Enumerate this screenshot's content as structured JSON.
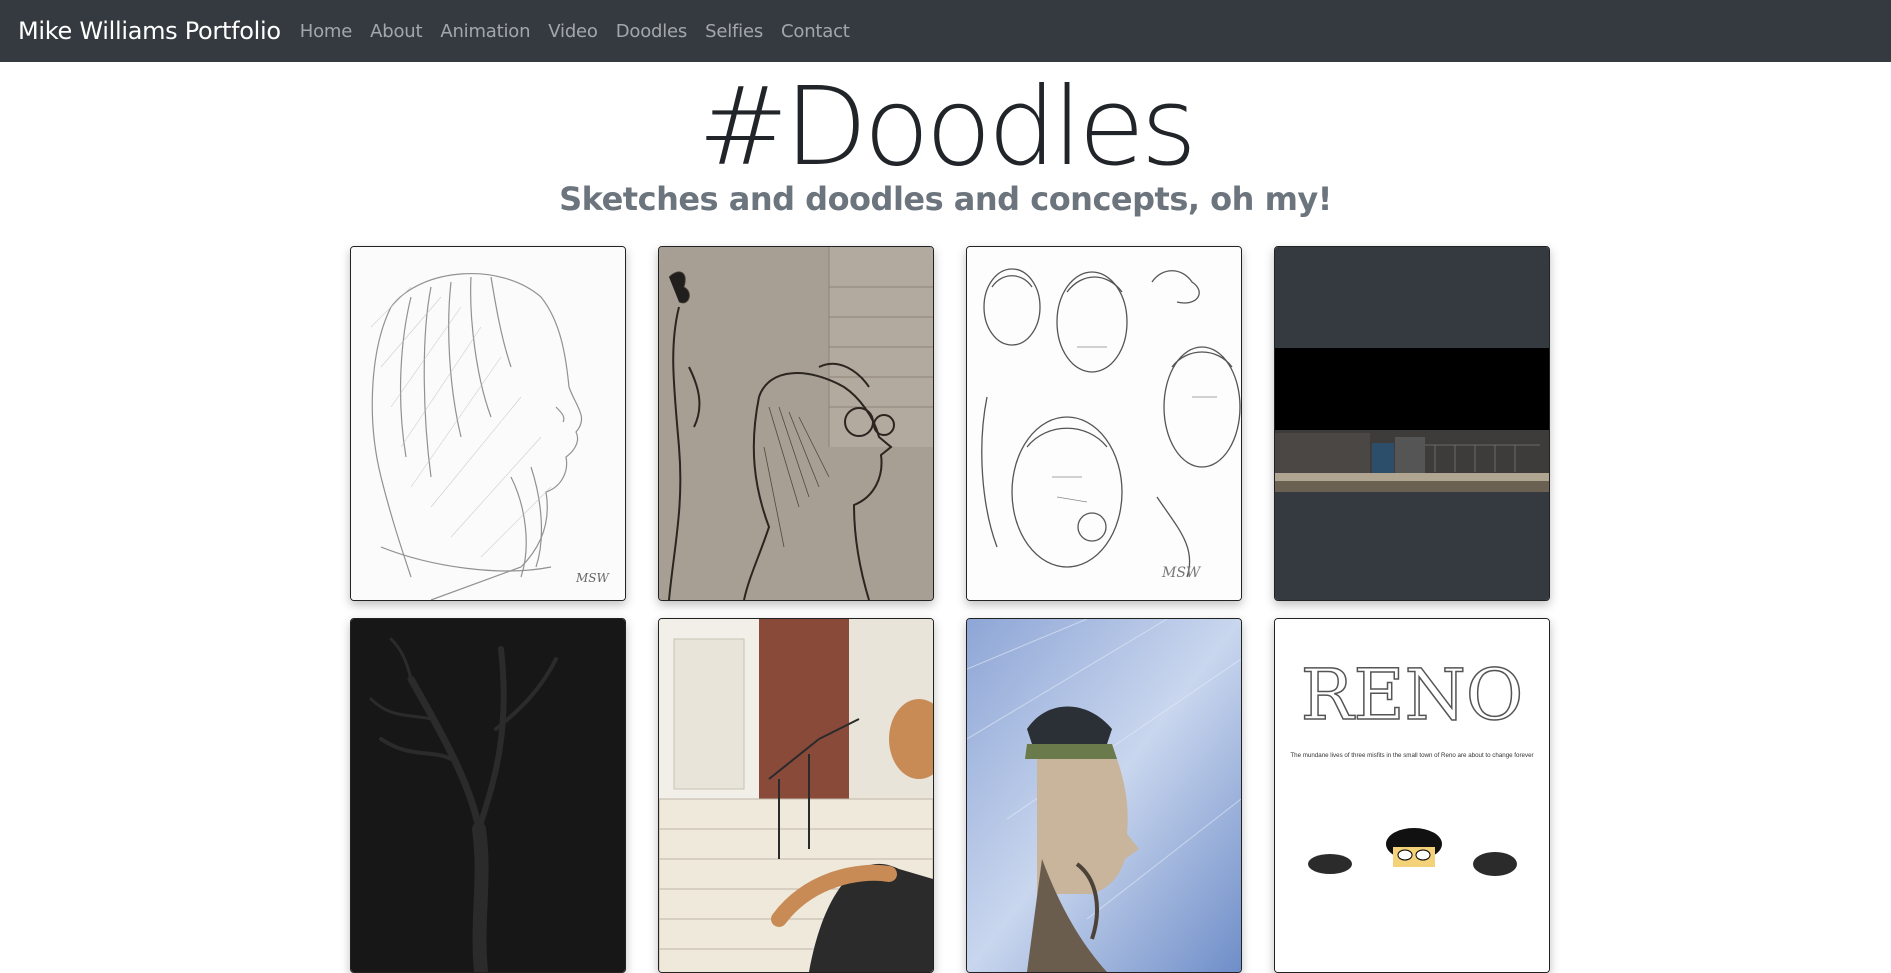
{
  "navbar": {
    "brand": "Mike Williams Portfolio",
    "links": [
      "Home",
      "About",
      "Animation",
      "Video",
      "Doodles",
      "Selfies",
      "Contact"
    ]
  },
  "header": {
    "title": "#Doodles",
    "subtitle": "Sketches and doodles and concepts, oh my!"
  },
  "gallery": {
    "items": [
      {
        "subject": "profile-sketch-bearded-man"
      },
      {
        "subject": "sepia-sketch-man-glasses"
      },
      {
        "subject": "character-sketches-monks"
      },
      {
        "subject": "dark-street-scene"
      },
      {
        "subject": "dark-tree-render"
      },
      {
        "subject": "3d-render-stairs-character"
      },
      {
        "subject": "painted-bearded-man-blue"
      },
      {
        "subject": "reno-poster",
        "logo_text": "RENO",
        "tagline": "The mundane lives of three misfits in the small town of Reno are about to change forever"
      }
    ]
  },
  "colors": {
    "navbar": "#343a40",
    "brand": "#ffffff",
    "nav_link": "rgba(255,255,255,0.55)",
    "subtitle": "#6c757d"
  }
}
